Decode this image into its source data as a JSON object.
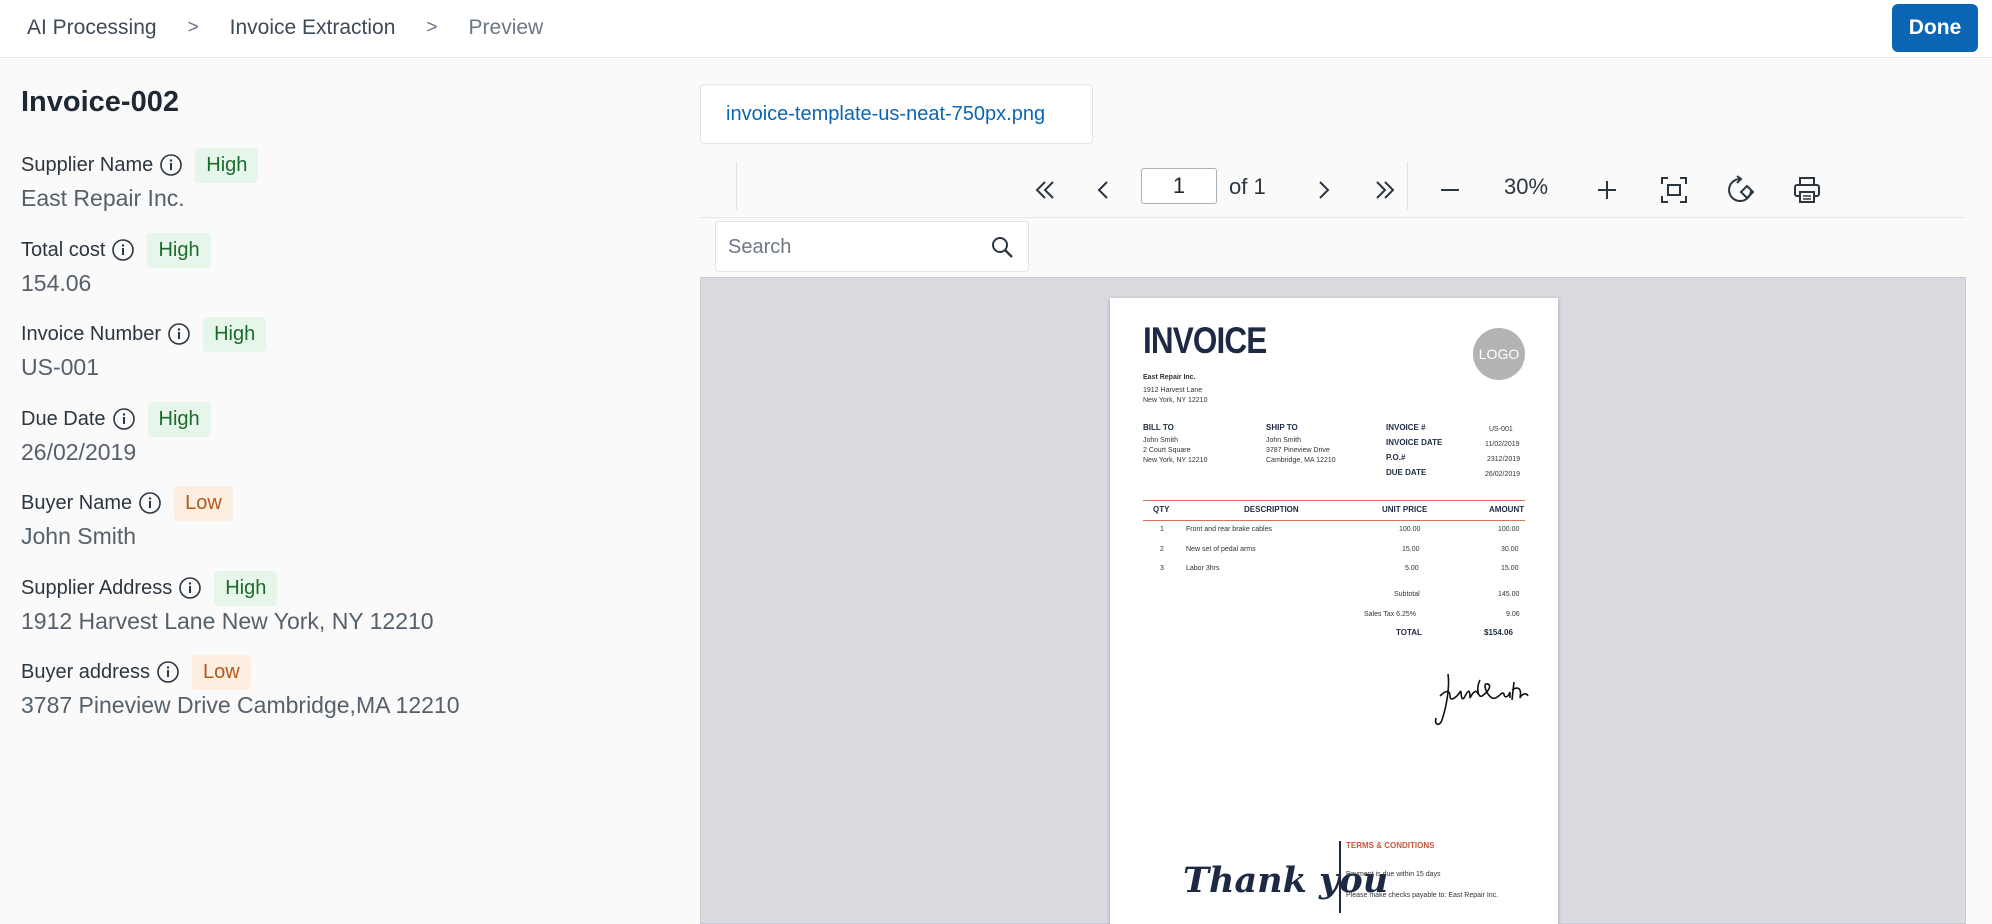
{
  "breadcrumb": {
    "items": [
      "AI Processing",
      "Invoice Extraction",
      "Preview"
    ],
    "separator": ">"
  },
  "done_label": "Done",
  "document_title": "Invoice-002",
  "fields": [
    {
      "label": "Supplier Name",
      "confidence": "High",
      "value": "East Repair Inc."
    },
    {
      "label": "Total cost",
      "confidence": "High",
      "value": "154.06"
    },
    {
      "label": "Invoice Number",
      "confidence": "High",
      "value": "US-001"
    },
    {
      "label": "Due Date",
      "confidence": "High",
      "value": "26/02/2019"
    },
    {
      "label": "Buyer Name",
      "confidence": "Low",
      "value": "John Smith"
    },
    {
      "label": "Supplier Address",
      "confidence": "High",
      "value": "1912 Harvest Lane New York, NY 12210"
    },
    {
      "label": "Buyer address",
      "confidence": "Low",
      "value": "3787 Pineview Drive Cambridge,MA 12210"
    }
  ],
  "viewer": {
    "file_name": "invoice-template-us-neat-750px.png",
    "current_page": "1",
    "of_pages": "of 1",
    "zoom": "30%",
    "search_placeholder": "Search"
  },
  "invoice": {
    "title": "INVOICE",
    "logo": "LOGO",
    "from": [
      "East Repair Inc.",
      "1912 Harvest Lane",
      "New York, NY 12210"
    ],
    "bill_to_label": "BILL TO",
    "bill_to": [
      "John Smith",
      "2 Court Square",
      "New York, NY 12210"
    ],
    "ship_to_label": "SHIP TO",
    "ship_to": [
      "John Smith",
      "3787 Pineview Drive",
      "Cambridge, MA 12210"
    ],
    "meta": [
      {
        "label": "INVOICE #",
        "value": "US-001"
      },
      {
        "label": "INVOICE DATE",
        "value": "11/02/2019"
      },
      {
        "label": "P.O.#",
        "value": "2312/2019"
      },
      {
        "label": "DUE DATE",
        "value": "26/02/2019"
      }
    ],
    "columns": [
      "QTY",
      "DESCRIPTION",
      "UNIT PRICE",
      "AMOUNT"
    ],
    "rows": [
      {
        "qty": "1",
        "desc": "Front and rear brake cables",
        "unit": "100.00",
        "amount": "100.00"
      },
      {
        "qty": "2",
        "desc": "New set of pedal arms",
        "unit": "15.00",
        "amount": "30.00"
      },
      {
        "qty": "3",
        "desc": "Labor 3hrs",
        "unit": "5.00",
        "amount": "15.00"
      }
    ],
    "subtotal_label": "Subtotal",
    "subtotal": "145.00",
    "tax_label": "Sales Tax 6.25%",
    "tax": "9.06",
    "total_label": "TOTAL",
    "total": "$154.06",
    "signature": "John Smith",
    "thank_you": "Thank you",
    "terms_title": "TERMS & CONDITIONS",
    "terms": [
      "Payment is due within 15 days",
      "Please make checks payable to: East Repair Inc."
    ]
  },
  "colors": {
    "accent": "#0a66b5",
    "high_bg": "#e7f6ea",
    "high_text": "#1d6b2b",
    "low_bg": "#fdeee2",
    "low_text": "#b4571a",
    "invoice_navy": "#1e2a44",
    "invoice_rule": "#d8735a"
  }
}
